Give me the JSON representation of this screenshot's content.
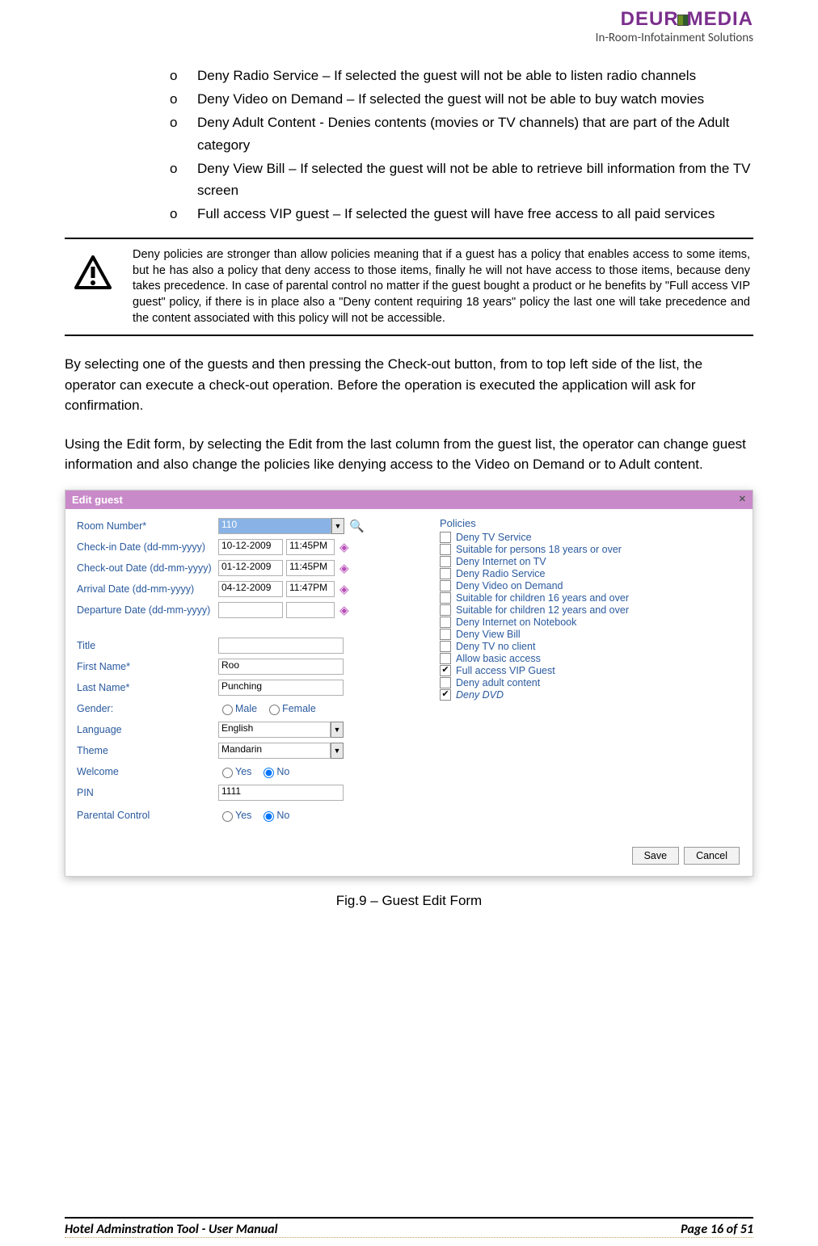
{
  "logo": {
    "main": "DEUR",
    "main2": "MEDIA",
    "sub": "In-Room-Infotainment Solutions"
  },
  "bullets": [
    "Deny Radio Service – If selected the guest will not be able to listen radio channels",
    "Deny Video on Demand – If selected the guest will not be able to buy watch movies",
    "Deny Adult Content - Denies contents (movies or TV channels) that are part of the Adult category",
    "Deny View Bill – If selected the guest will not be able to retrieve bill information from the TV screen",
    " Full access VIP guest – If selected the guest will have free access to all paid services"
  ],
  "warning": "Deny policies are stronger than allow policies meaning that if a guest has a policy that enables access to some items, but he has also a policy that deny access to those items, finally he will not have access to those items, because deny takes precedence. In case of parental control no matter if the guest bought a product or he benefits by \"Full access VIP guest\" policy, if there is in place also a \"Deny content requiring 18 years\" policy the last one will take precedence and the content associated with this policy will not be accessible.",
  "para1": "By selecting one of the guests and then pressing the Check-out button, from to top left side of the list, the operator can execute a check-out operation. Before the operation is executed the application will ask for confirmation.",
  "para2": "Using the Edit form, by selecting the Edit from the last column from the guest list, the operator can change guest information and also change the policies like denying access to the Video on Demand or to Adult content.",
  "form": {
    "title": "Edit guest",
    "labels": {
      "room": "Room Number*",
      "checkin": "Check-in Date (dd-mm-yyyy)",
      "checkout": "Check-out Date (dd-mm-yyyy)",
      "arrival": "Arrival Date (dd-mm-yyyy)",
      "departure": "Departure Date (dd-mm-yyyy)",
      "titlef": "Title",
      "first": "First Name*",
      "last": "Last Name*",
      "gender": "Gender:",
      "language": "Language",
      "theme": "Theme",
      "welcome": "Welcome",
      "pin": "PIN",
      "parental": "Parental Control",
      "male": "Male",
      "female": "Female",
      "yes": "Yes",
      "no": "No"
    },
    "values": {
      "room": "110",
      "checkin_d": "10-12-2009",
      "checkin_t": "11:45PM",
      "checkout_d": "01-12-2009",
      "checkout_t": "11:45PM",
      "arrival_d": "04-12-2009",
      "arrival_t": "11:47PM",
      "departure_d": "",
      "departure_t": "",
      "titlef": "",
      "first": "Roo",
      "last": "Punching",
      "language": "English",
      "theme": "Mandarin",
      "pin": "1111"
    },
    "policies_title": "Policies",
    "policies": [
      {
        "label": "Deny TV Service",
        "checked": false
      },
      {
        "label": "Suitable for persons 18 years or over",
        "checked": false
      },
      {
        "label": "Deny Internet on TV",
        "checked": false
      },
      {
        "label": "Deny Radio Service",
        "checked": false
      },
      {
        "label": "Deny Video on Demand",
        "checked": false
      },
      {
        "label": "Suitable for children 16 years and over",
        "checked": false
      },
      {
        "label": "Suitable for children 12 years and over",
        "checked": false
      },
      {
        "label": "Deny Internet on Notebook",
        "checked": false
      },
      {
        "label": "Deny View Bill",
        "checked": false
      },
      {
        "label": "Deny TV no client",
        "checked": false
      },
      {
        "label": "Allow basic access",
        "checked": false
      },
      {
        "label": "Full access VIP Guest",
        "checked": true
      },
      {
        "label": "Deny adult content",
        "checked": false
      },
      {
        "label": "Deny DVD",
        "checked": true,
        "italic": true
      }
    ],
    "buttons": {
      "save": "Save",
      "cancel": "Cancel"
    }
  },
  "caption": "Fig.9 – Guest Edit Form",
  "footer": {
    "left": "Hotel Adminstration Tool - User Manual",
    "right": "Page 16 of 51"
  }
}
